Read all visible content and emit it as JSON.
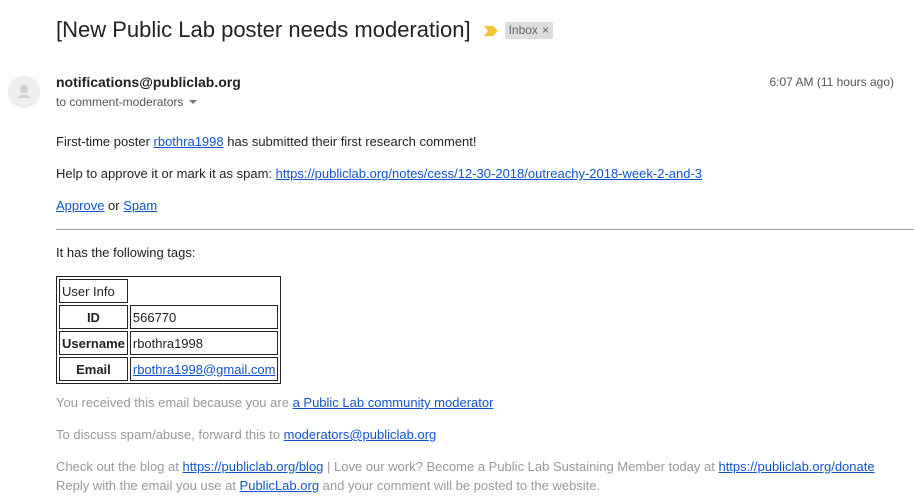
{
  "subject": "[New Public Lab poster needs moderation]",
  "label": {
    "name": "Inbox",
    "remove": "×"
  },
  "sender": "notifications@publiclab.org",
  "recipients": "to comment-moderators",
  "timestamp": "6:07 AM (11 hours ago)",
  "body": {
    "p1_prefix": "First-time poster ",
    "p1_user": "rbothra1998",
    "p1_suffix": " has submitted their first research comment!",
    "p2_prefix": "Help to approve it or mark it as spam: ",
    "p2_link": "https://publiclab.org/notes/cess/12-30-2018/outreachy-2018-week-2-and-3",
    "approve": "Approve",
    "or": " or ",
    "spam": "Spam",
    "tags_text": "It has the following tags:"
  },
  "table": {
    "header": "User Info",
    "rows": [
      {
        "key": "ID",
        "value": "566770"
      },
      {
        "key": "Username",
        "value": "rbothra1998"
      },
      {
        "key": "Email",
        "value": "rbothra1998@gmail.com"
      }
    ]
  },
  "footer": {
    "f1_prefix": "You received this email because you are ",
    "f1_link": "a Public Lab community moderator",
    "f2_prefix": "To discuss spam/abuse, forward this to ",
    "f2_link": "moderators@publiclab.org",
    "f3_prefix": "Check out the blog at ",
    "f3_link1": "https://publiclab.org/blog",
    "f3_middle": " | Love our work? Become a Public Lab Sustaining Member today at ",
    "f3_link2": "https://publiclab.org/donate",
    "f4_prefix": "Reply with the email you use at ",
    "f4_link": "PublicLab.org",
    "f4_suffix": " and your comment will be posted to the website."
  },
  "colors": {
    "link": "#1155cc",
    "importance": "#f4c430",
    "label_bg": "#dddddd"
  }
}
